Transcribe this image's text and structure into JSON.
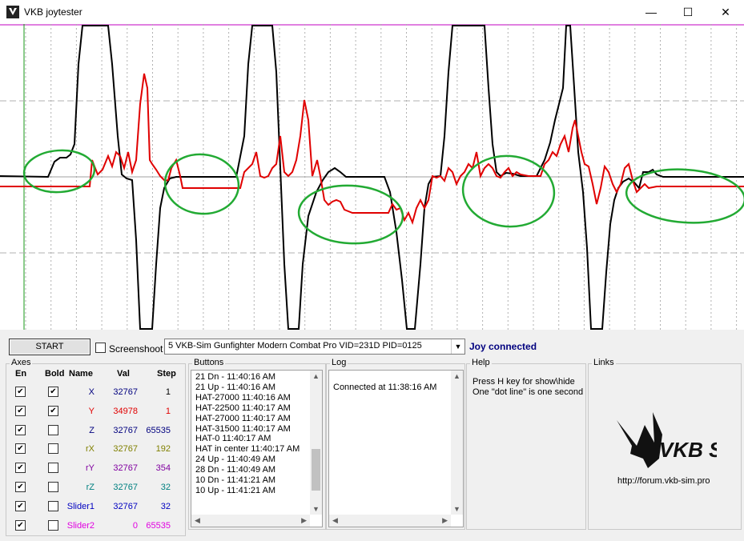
{
  "window": {
    "title": "VKB joytester",
    "minimize": "—",
    "maximize": "☐",
    "close": "✕"
  },
  "toolbar": {
    "start_label": "START",
    "screenshot_label": "Screenshoot",
    "device": "5  VKB-Sim Gunfighter Modern Combat Pro  VID=231D PID=0125",
    "status": "Joy connected"
  },
  "colors": {
    "status": "#00007f",
    "trace_red": "#e00000",
    "trace_black": "#000000",
    "annotation_green": "#22aa33",
    "top_line": "#c000c0"
  },
  "axes": {
    "caption": "Axes",
    "headers": [
      "En",
      "Bold",
      "Name",
      "Val",
      "Step"
    ],
    "rows": [
      {
        "en": true,
        "bold": true,
        "name": "X",
        "val": "32767",
        "step": "1",
        "color": "#00007f"
      },
      {
        "en": true,
        "bold": true,
        "name": "Y",
        "val": "34978",
        "step": "1",
        "color": "#e00000"
      },
      {
        "en": true,
        "bold": false,
        "name": "Z",
        "val": "32767",
        "step": "65535",
        "color": "#00007f"
      },
      {
        "en": true,
        "bold": false,
        "name": "rX",
        "val": "32767",
        "step": "192",
        "color": "#808000"
      },
      {
        "en": true,
        "bold": false,
        "name": "rY",
        "val": "32767",
        "step": "354",
        "color": "#8000a0"
      },
      {
        "en": true,
        "bold": false,
        "name": "rZ",
        "val": "32767",
        "step": "32",
        "color": "#008080"
      },
      {
        "en": true,
        "bold": false,
        "name": "Slider1",
        "val": "32767",
        "step": "32",
        "color": "#0000c0"
      },
      {
        "en": true,
        "bold": false,
        "name": "Slider2",
        "val": "0",
        "step": "65535",
        "color": "#e000e0"
      }
    ]
  },
  "buttons_log": {
    "caption": "Buttons",
    "lines": [
      "21 Dn - 11:40:16 AM",
      "21 Up - 11:40:16 AM",
      "HAT-27000 11:40:16 AM",
      "HAT-22500 11:40:17 AM",
      "HAT-27000 11:40:17 AM",
      "HAT-31500 11:40:17 AM",
      "HAT-0 11:40:17 AM",
      "HAT in center 11:40:17 AM",
      "24 Up - 11:40:49 AM",
      "28 Dn - 11:40:49 AM",
      "10 Dn - 11:41:21 AM",
      "10 Up - 11:41:21 AM"
    ]
  },
  "log": {
    "caption": "Log",
    "lines": [
      "Connected at 11:38:16 AM"
    ]
  },
  "help": {
    "caption": "Help",
    "lines": [
      "Press H key for show\\hide",
      "One \"dot line\" is one second"
    ]
  },
  "links": {
    "caption": "Links",
    "logo_text": "VKB SIM",
    "url": "http://forum.vkb-sim.pro"
  }
}
